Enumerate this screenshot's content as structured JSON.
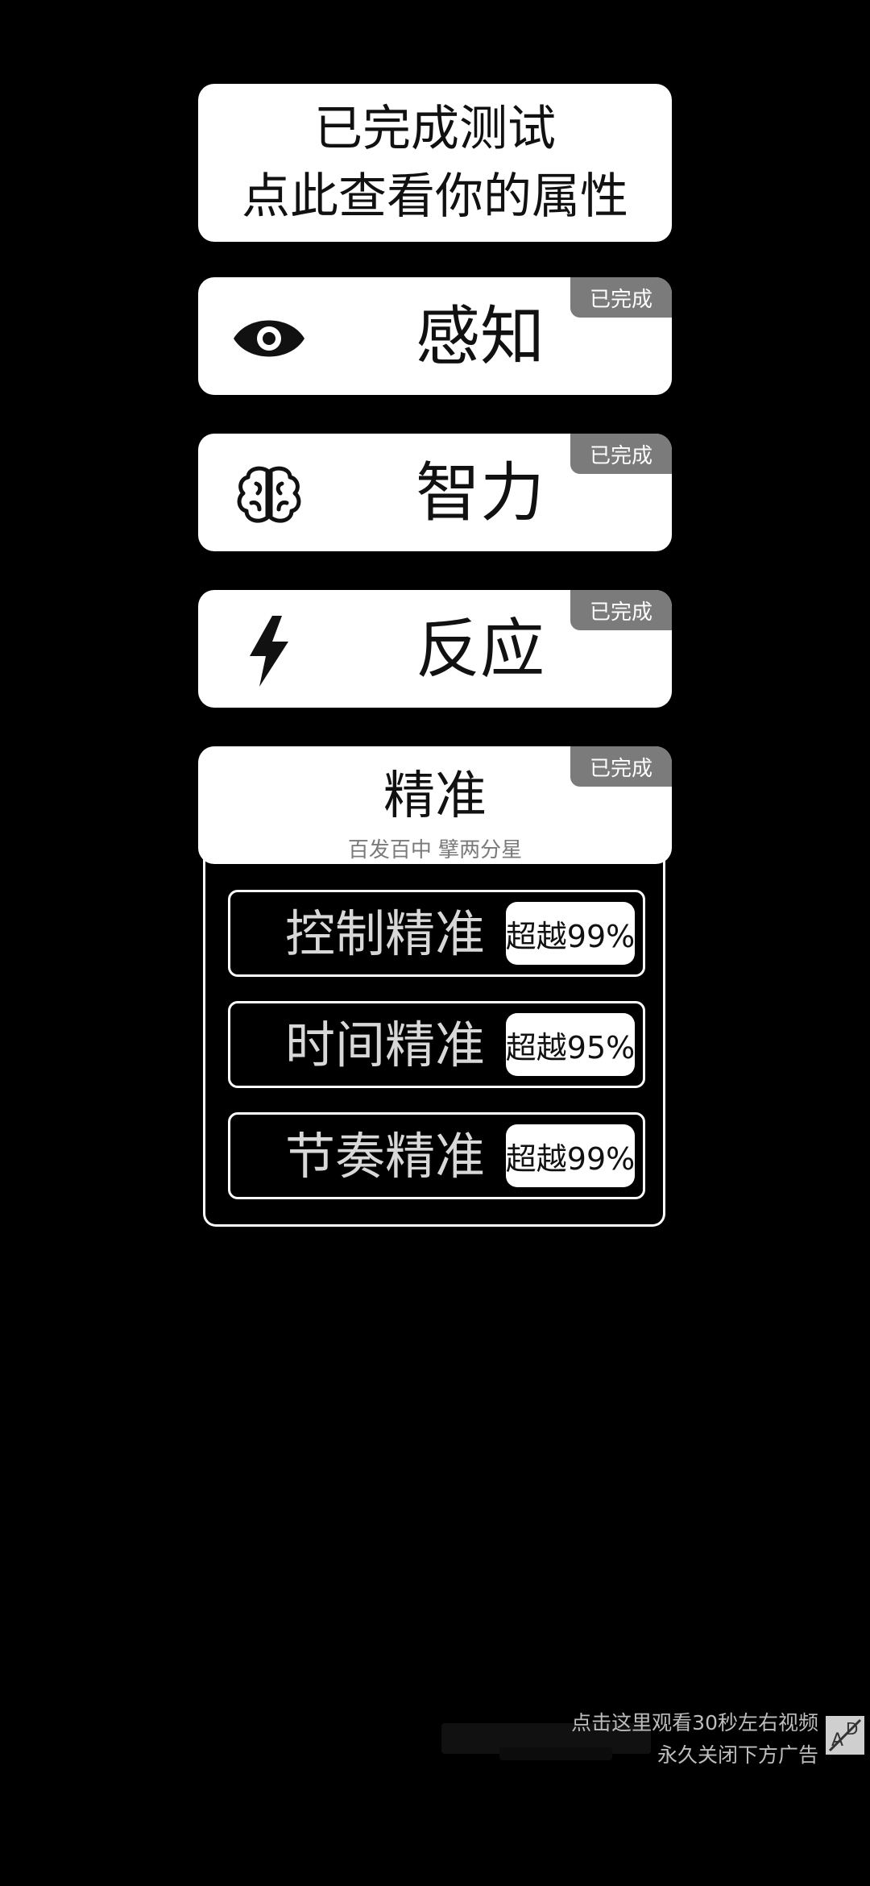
{
  "result_card": {
    "line1": "已完成测试",
    "line2": "点此查看你的属性"
  },
  "attributes": [
    {
      "title": "感知",
      "badge": "已完成",
      "icon": "eye-icon"
    },
    {
      "title": "智力",
      "badge": "已完成",
      "icon": "brain-icon"
    },
    {
      "title": "反应",
      "badge": "已完成",
      "icon": "lightning-icon"
    }
  ],
  "accuracy": {
    "title": "精准",
    "badge": "已完成",
    "subtitle": "百发百中 擘两分星",
    "rows": [
      {
        "label": "控制精准",
        "value": "超越99%"
      },
      {
        "label": "时间精准",
        "value": "超越95%"
      },
      {
        "label": "节奏精准",
        "value": "超越99%"
      }
    ]
  },
  "ad": {
    "line1": "点击这里观看30秒左右视频",
    "line2": "永久关闭下方广告",
    "icon": "ad-icon"
  }
}
